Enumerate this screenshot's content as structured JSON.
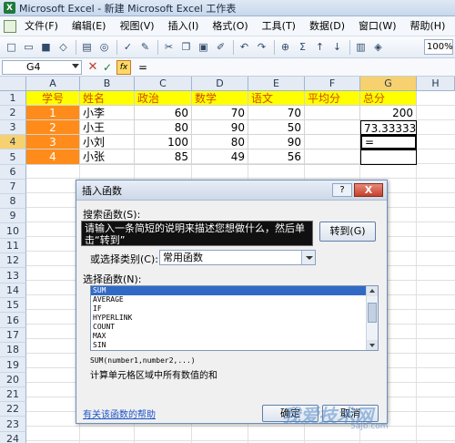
{
  "window": {
    "title": "Microsoft Excel - 新建 Microsoft Excel 工作表",
    "app_logo": "X"
  },
  "menu": [
    "文件(F)",
    "编辑(E)",
    "视图(V)",
    "插入(I)",
    "格式(O)",
    "工具(T)",
    "数据(D)",
    "窗口(W)",
    "帮助(H)"
  ],
  "toolbar": {
    "zoom": "100%"
  },
  "formula_bar": {
    "name_box": "G4",
    "content": "=",
    "fx": "fx"
  },
  "columns": [
    "A",
    "B",
    "C",
    "D",
    "E",
    "F",
    "G",
    "H"
  ],
  "rows": [
    "1",
    "2",
    "3",
    "4",
    "5",
    "6",
    "7",
    "8",
    "9",
    "10",
    "11",
    "12",
    "13",
    "14",
    "15",
    "16",
    "17",
    "18",
    "19",
    "20",
    "21",
    "22",
    "23",
    "24"
  ],
  "sheet": {
    "headers": [
      "学号",
      "姓名",
      "政治",
      "数学",
      "语文",
      "平均分",
      "总分"
    ],
    "records": [
      {
        "id": "1",
        "name": "小李",
        "politics": "60",
        "math": "70",
        "chinese": "70",
        "avg": "",
        "total": "200"
      },
      {
        "id": "2",
        "name": "小王",
        "politics": "80",
        "math": "90",
        "chinese": "50",
        "avg": "",
        "total": "73.33333"
      },
      {
        "id": "3",
        "name": "小刘",
        "politics": "100",
        "math": "80",
        "chinese": "90",
        "avg": "",
        "total": "="
      },
      {
        "id": "4",
        "name": "小张",
        "politics": "85",
        "math": "49",
        "chinese": "56",
        "avg": "",
        "total": ""
      }
    ]
  },
  "dialog": {
    "title": "插入函数",
    "help_button": "?",
    "close_button": "X",
    "search_label": "搜索函数(S):",
    "search_text": "请输入一条简短的说明来描述您想做什么，然后单击“转到”",
    "goto_button": "转到(G)",
    "category_label": "或选择类别(C):",
    "category_value": "常用函数",
    "select_label": "选择函数(N):",
    "functions": [
      "SUM",
      "AVERAGE",
      "IF",
      "HYPERLINK",
      "COUNT",
      "MAX",
      "SIN"
    ],
    "selected_function": "SUM",
    "signature": "SUM(number1,number2,...)",
    "description": "计算单元格区域中所有数值的和",
    "help_link": "有关该函数的帮助",
    "ok_button": "确定",
    "cancel_button": "取消"
  },
  "watermark": {
    "text": "我爱技术网",
    "sub": "5ajb.com"
  }
}
